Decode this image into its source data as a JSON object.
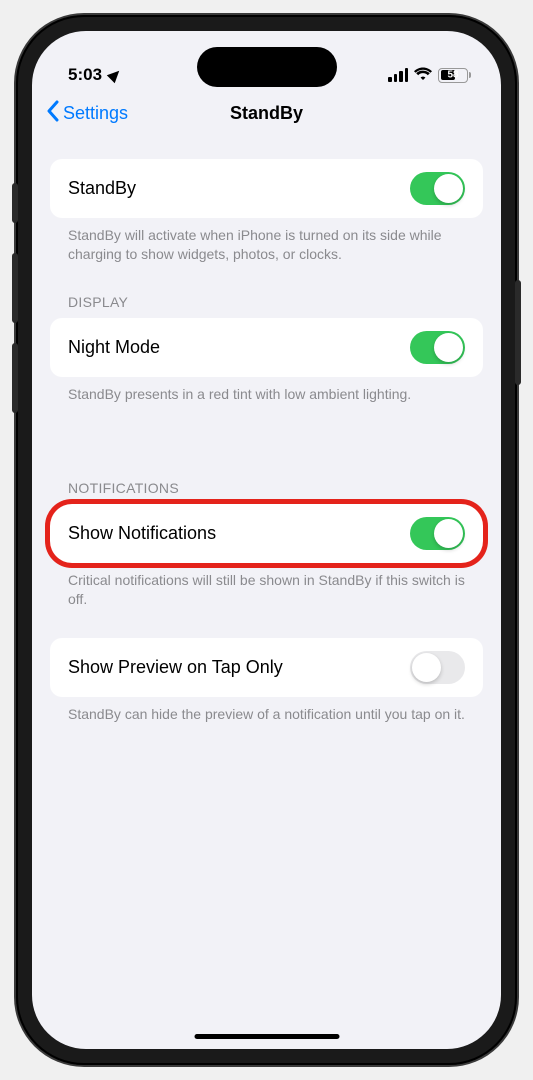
{
  "status": {
    "time": "5:03",
    "battery": "58"
  },
  "nav": {
    "back": "Settings",
    "title": "StandBy"
  },
  "sections": {
    "main": {
      "label": "StandBy",
      "footer": "StandBy will activate when iPhone is turned on its side while charging to show widgets, photos, or clocks."
    },
    "display": {
      "header": "DISPLAY",
      "night_mode_label": "Night Mode",
      "footer": "StandBy presents in a red tint with low ambient lighting."
    },
    "notifications": {
      "header": "NOTIFICATIONS",
      "show_label": "Show Notifications",
      "show_footer": "Critical notifications will still be shown in StandBy if this switch is off.",
      "preview_label": "Show Preview on Tap Only",
      "preview_footer": "StandBy can hide the preview of a notification until you tap on it."
    }
  }
}
